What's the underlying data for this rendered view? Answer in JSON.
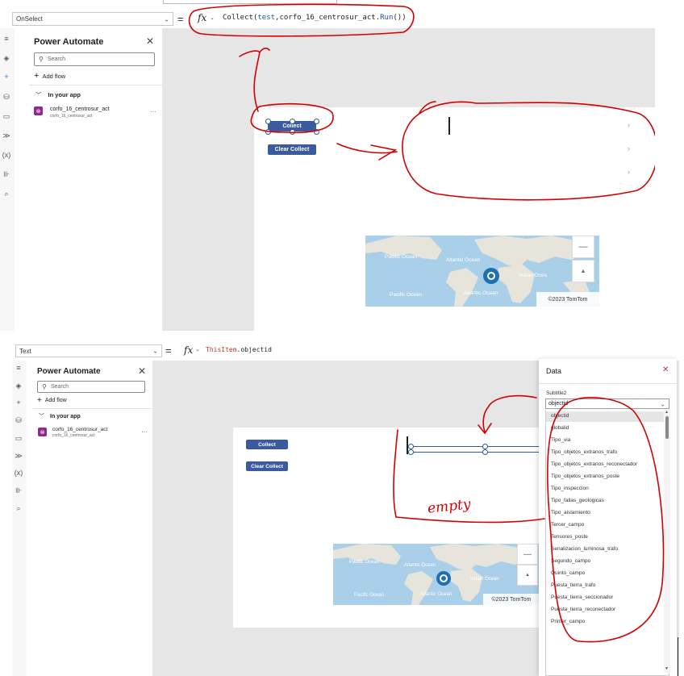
{
  "top": {
    "property": "OnSelect",
    "formula_fn": "Collect",
    "formula_arg1": "test",
    "formula_arg2": "corfo_16_centrosur_act",
    "formula_method": "Run",
    "panel": {
      "title": "Power Automate",
      "search_placeholder": "Search",
      "add_flow": "Add flow",
      "section": "In your app",
      "flow_name": "corfo_16_centrosur_act",
      "flow_sub": "corfo_16_centrosur_act"
    },
    "buttons": {
      "collect": "Collect",
      "clear_collect": "Clear Collect"
    },
    "map": {
      "pacific1": "Pacific Ocean",
      "atlantic1": "Atlantic Ocean",
      "indian": "Indian Ocea",
      "pacific2": "Pacific Ocean",
      "atlantic2": "Atlantic Ocean",
      "attribution": "©2023 TomTom"
    }
  },
  "bottom": {
    "property": "Text",
    "formula_obj": "ThisItem",
    "formula_field": "objectid",
    "panel": {
      "title": "Power Automate",
      "search_placeholder": "Search",
      "add_flow": "Add flow",
      "section": "In your app",
      "flow_name": "corfo_16_centrosur_act",
      "flow_sub": "corfo_16_centrosur_act"
    },
    "buttons": {
      "collect": "Collect",
      "clear_collect": "Clear Collect"
    },
    "annotation": "empty",
    "map": {
      "pacific1": "Pacific Ocean",
      "atlantic1": "Atlantic Ocean",
      "indian": "Indian Ocean",
      "pacific2": "Pacific Ocean",
      "atlantic2": "Atlantic Ocean",
      "attribution": "©2023 TomTom"
    },
    "data_pane": {
      "title": "Data",
      "subtitle_label": "Subtitle2",
      "selected_value": "objectid",
      "fields": [
        "objectid",
        "globalid",
        "Tipo_via",
        "Tipo_objetos_extranos_trafo",
        "Tipo_objetos_extranos_reconectador",
        "Tipo_objetos_extranos_poste",
        "Tipo_inspeccion",
        "Tipo_fallas_geologicas",
        "Tipo_aislamiento",
        "Tercer_campo",
        "Tensores_poste",
        "Senalizacion_luminosa_trafo",
        "Segundo_campo",
        "Quinto_campo",
        "Puesta_tierra_trafo",
        "Puesta_tierra_seccionador",
        "Puesta_tierra_reconectador",
        "Primer_campo"
      ]
    }
  }
}
